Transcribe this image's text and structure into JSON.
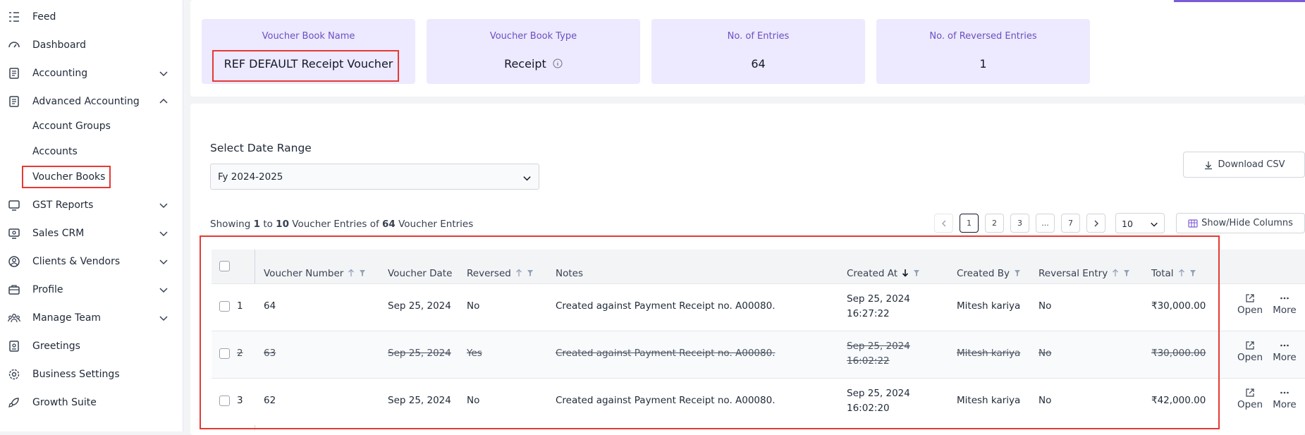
{
  "sidebar": {
    "items": [
      {
        "label": "Feed",
        "icon": "feed-icon"
      },
      {
        "label": "Dashboard",
        "icon": "dashboard-icon"
      },
      {
        "label": "Accounting",
        "icon": "document-icon"
      },
      {
        "label": "Advanced Accounting",
        "icon": "document-icon"
      },
      {
        "label": "GST Reports",
        "icon": "gst-icon"
      },
      {
        "label": "Sales CRM",
        "icon": "crm-icon"
      },
      {
        "label": "Clients & Vendors",
        "icon": "user-circle-icon"
      },
      {
        "label": "Profile",
        "icon": "briefcase-icon"
      },
      {
        "label": "Manage Team",
        "icon": "team-icon"
      },
      {
        "label": "Greetings",
        "icon": "greetings-icon"
      },
      {
        "label": "Business Settings",
        "icon": "settings-icon"
      },
      {
        "label": "Growth Suite",
        "icon": "rocket-icon"
      }
    ],
    "subitems": [
      "Account Groups",
      "Accounts",
      "Voucher Books"
    ]
  },
  "stats": [
    {
      "title": "Voucher Book Name",
      "value": "REF DEFAULT Receipt Voucher"
    },
    {
      "title": "Voucher Book Type",
      "value": "Receipt"
    },
    {
      "title": "No. of Entries",
      "value": "64"
    },
    {
      "title": "No. of Reversed Entries",
      "value": "1"
    }
  ],
  "date_range": {
    "label": "Select Date Range",
    "value": "Fy 2024-2025"
  },
  "download_label": "Download CSV",
  "showing": {
    "prefix": "Showing",
    "from": "1",
    "to_word": "to",
    "to": "10",
    "mid": "Voucher Entries of",
    "total": "64",
    "suffix": "Voucher Entries"
  },
  "pagination": {
    "pages": [
      "1",
      "2",
      "3",
      "...",
      "7"
    ],
    "current": "1",
    "page_size": "10"
  },
  "show_hide_label": "Show/Hide Columns",
  "columns": [
    "Voucher Number",
    "Voucher Date",
    "Reversed",
    "Notes",
    "Created At",
    "Created By",
    "Reversal Entry",
    "Total"
  ],
  "rows": [
    {
      "idx": "1",
      "number": "64",
      "date": "Sep 25, 2024",
      "reversed": "No",
      "notes": "Created against Payment Receipt no. A00080.",
      "created_date": "Sep 25, 2024",
      "created_time": "16:27:22",
      "created_by": "Mitesh kariya",
      "reversal_entry": "No",
      "total": "₹30,000.00",
      "struck": false
    },
    {
      "idx": "2",
      "number": "63",
      "date": "Sep 25, 2024",
      "reversed": "Yes",
      "notes": "Created against Payment Receipt no. A00080.",
      "created_date": "Sep 25, 2024",
      "created_time": "16:02:22",
      "created_by": "Mitesh kariya",
      "reversal_entry": "No",
      "total": "₹30,000.00",
      "struck": true
    },
    {
      "idx": "3",
      "number": "62",
      "date": "Sep 25, 2024",
      "reversed": "No",
      "notes": "Created against Payment Receipt no. A00080.",
      "created_date": "Sep 25, 2024",
      "created_time": "16:02:20",
      "created_by": "Mitesh kariya",
      "reversal_entry": "No",
      "total": "₹42,000.00",
      "struck": false
    }
  ],
  "actions": {
    "open": "Open",
    "more": "More"
  },
  "colors": {
    "accent": "#7c5cd6",
    "stat_bg": "#ede9fe",
    "highlight": "#e53935"
  }
}
